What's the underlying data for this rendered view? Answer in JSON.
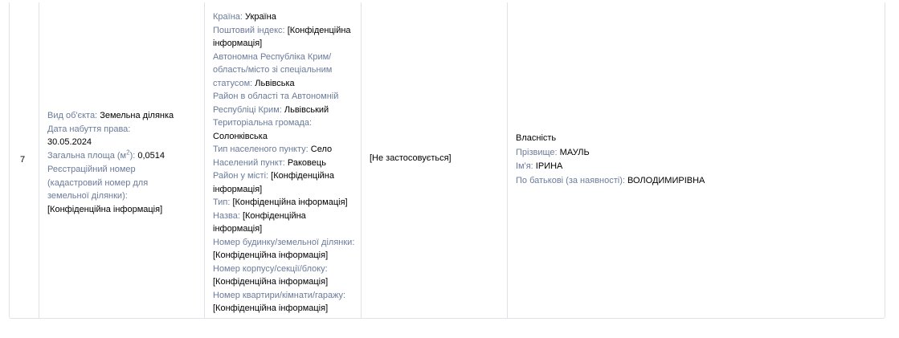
{
  "row": {
    "number": "7",
    "object": {
      "type_label": "Вид об'єкта:",
      "type_value": "Земельна ділянка",
      "date_label": "Дата набуття права:",
      "date_value": "30.05.2024",
      "area_label_pre": "Загальна площа (м",
      "area_label_sup": "2",
      "area_label_post": "):",
      "area_value": "0,0514",
      "cadastral_label": "Реєстраційний номер (кадастровий номер для земельної ділянки):",
      "cadastral_value": "[Конфіденційна інформація]"
    },
    "address": [
      {
        "label": "Країна:",
        "value": "Україна"
      },
      {
        "label": "Поштовий індекс:",
        "value": "[Конфіденційна інформація]"
      },
      {
        "label": "Автономна Республіка Крим/ область/місто зі спеціальним статусом:",
        "value": "Львівська"
      },
      {
        "label": "Район в області та Автономній Республіці Крим:",
        "value": "Львівський"
      },
      {
        "label": "Територіальна громада:",
        "value": "Солонківська"
      },
      {
        "label": "Тип населеного пункту:",
        "value": "Село"
      },
      {
        "label": "Населений пункт:",
        "value": "Раковець"
      },
      {
        "label": "Район у місті:",
        "value": "[Конфіденційна інформація]"
      },
      {
        "label": "Тип:",
        "value": "[Конфіденційна інформація]"
      },
      {
        "label": "Назва:",
        "value": "[Конфіденційна інформація]"
      },
      {
        "label": "Номер будинку/земельної ділянки:",
        "value": "[Конфіденційна інформація]"
      },
      {
        "label": "Номер корпусу/секції/блоку:",
        "value": "[Конфіденційна інформація]"
      },
      {
        "label": "Номер квартири/кімнати/гаражу:",
        "value": "[Конфіденційна інформація]"
      }
    ],
    "share": "[Не застосовується]",
    "owner": {
      "right_type": "Власність",
      "surname_label": "Прізвище:",
      "surname_value": "МАУЛЬ",
      "name_label": "Ім'я:",
      "name_value": "ІРИНА",
      "patronymic_label": "По батькові (за наявності):",
      "patronymic_value": "ВОЛОДИМИРІВНА"
    }
  }
}
